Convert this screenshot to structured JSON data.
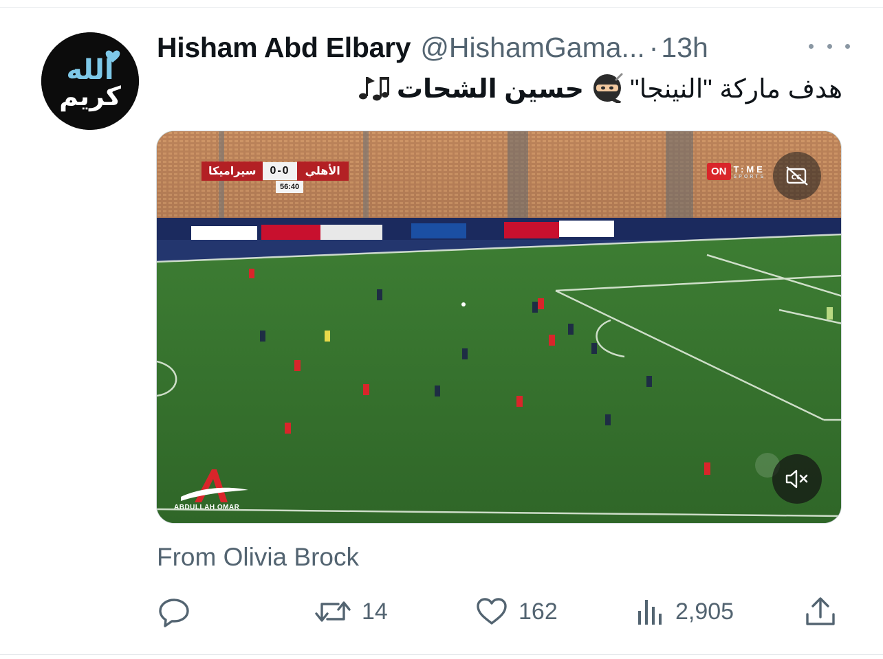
{
  "tweet": {
    "display_name": "Hisham Abd Elbary",
    "handle": "@HishamGama...",
    "separator": "·",
    "time": "13h",
    "text_plain": "هدف ماركة \"النينجا\"",
    "text_bold": "حسين الشحات",
    "emoji_ninja": "ninja-emoji",
    "emoji_music": "musical-notes-emoji",
    "source_line": "From Olivia Brock"
  },
  "avatar": {
    "text_line1": "الله",
    "text_line2": "كريم",
    "bg_color": "#0c0c0c",
    "accent_color": "#7ec8e8"
  },
  "media": {
    "scoreboard": {
      "team_home": "الأهلي",
      "score": "0-0",
      "team_away": "سيراميكا",
      "clock": "56:40"
    },
    "channel_badge": {
      "on": "ON",
      "time": "T:ME",
      "sports": "SPORTS"
    },
    "watermark_text": "ABDULLAH OMAR",
    "cc_icon": "closed-captions-off-icon",
    "mute_icon": "speaker-muted-icon"
  },
  "actions": {
    "reply": {
      "icon": "reply-icon",
      "count": ""
    },
    "retweet": {
      "icon": "retweet-icon",
      "count": "14"
    },
    "like": {
      "icon": "heart-icon",
      "count": "162"
    },
    "views": {
      "icon": "views-chart-icon",
      "count": "2,905"
    },
    "share": {
      "icon": "share-icon"
    }
  },
  "colors": {
    "text_primary": "#0f1419",
    "text_secondary": "#536471",
    "pitch_green": "#2f6a2a"
  }
}
